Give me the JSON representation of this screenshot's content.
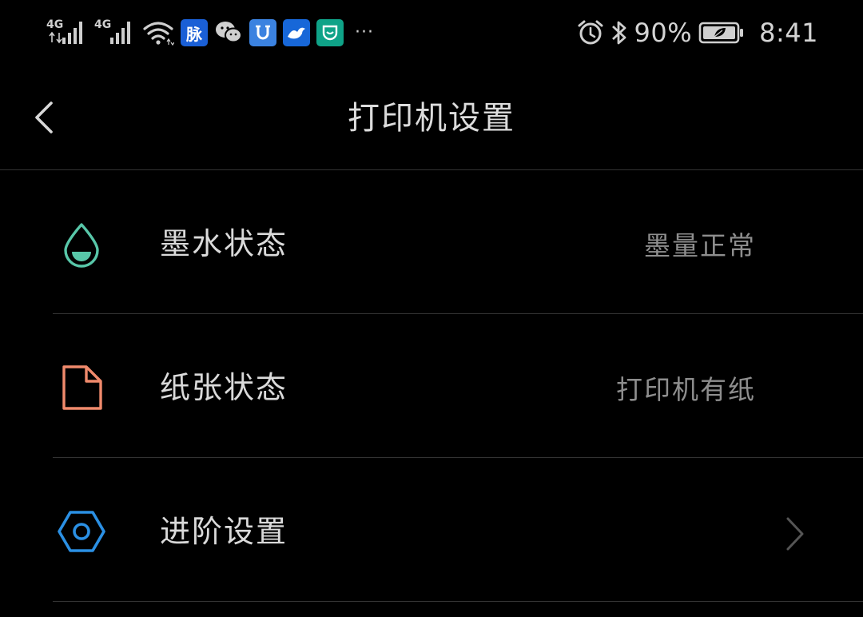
{
  "status_bar": {
    "sim1_network": "4G",
    "sim2_network": "4G",
    "apps": [
      {
        "name": "maimai",
        "glyph": "脉",
        "color": "#1a5fd6"
      },
      {
        "name": "wechat",
        "glyph": "",
        "color": "#000000"
      },
      {
        "name": "app-blue-u",
        "glyph": "U",
        "color": "#3b82e0"
      },
      {
        "name": "app-bird",
        "glyph": "",
        "color": "#1767d8"
      },
      {
        "name": "mijia",
        "glyph": "",
        "color": "#0fa388"
      }
    ],
    "more": "···",
    "battery_percent": "90%",
    "time": "8:41"
  },
  "header": {
    "title": "打印机设置"
  },
  "settings": [
    {
      "icon": "ink-drop-icon",
      "label": "墨水状态",
      "value": "墨量正常",
      "icon_color": "#58c7a9"
    },
    {
      "icon": "paper-icon",
      "label": "纸张状态",
      "value": "打印机有纸",
      "icon_color": "#f08a6c"
    },
    {
      "icon": "hex-gear-icon",
      "label": "进阶设置",
      "value": "",
      "icon_color": "#2b90e4"
    }
  ],
  "colors": {
    "background": "#000000",
    "divider": "#333333",
    "label_text": "#dadada",
    "value_text": "#8e8e8e"
  }
}
